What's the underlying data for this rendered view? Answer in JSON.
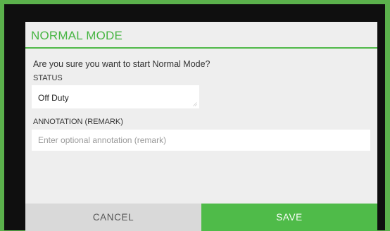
{
  "dialog": {
    "title": "NORMAL MODE",
    "question": "Are you sure you want to start Normal Mode?",
    "status": {
      "label": "STATUS",
      "selected": "Off Duty"
    },
    "annotation": {
      "label": "ANNOTATION (REMARK)",
      "value": "",
      "placeholder": "Enter optional annotation (remark)"
    },
    "buttons": {
      "cancel": "CANCEL",
      "save": "SAVE"
    }
  },
  "icons": {
    "resize": "resize-grip-icon"
  },
  "colors": {
    "accent": "#4fbb49",
    "title": "#47b543",
    "dialog_bg": "#eeeeee",
    "frame": "#0f0f0f",
    "outer_bg": "#5bb14c",
    "cancel_bg": "#d9d9d9",
    "cancel_text": "#555555",
    "save_text": "#ffffff"
  }
}
